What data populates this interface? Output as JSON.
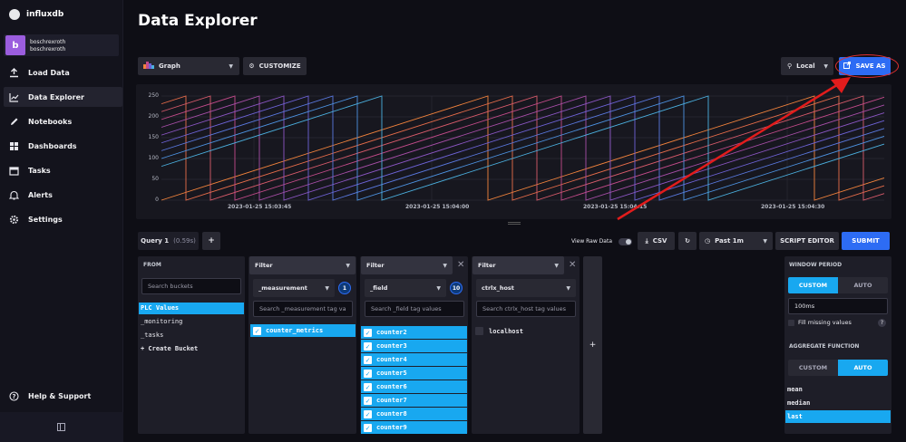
{
  "brand": "influxdb",
  "user": {
    "initial": "b",
    "line1": "boschrexroth",
    "line2": "boschrexroth"
  },
  "nav": [
    {
      "label": "Load Data",
      "icon": "upload-icon"
    },
    {
      "label": "Data Explorer",
      "icon": "graph-icon"
    },
    {
      "label": "Notebooks",
      "icon": "pencil-icon"
    },
    {
      "label": "Dashboards",
      "icon": "dashboard-icon"
    },
    {
      "label": "Tasks",
      "icon": "calendar-icon"
    },
    {
      "label": "Alerts",
      "icon": "bell-icon"
    },
    {
      "label": "Settings",
      "icon": "gear-icon"
    }
  ],
  "help": "Help & Support",
  "page_title": "Data Explorer",
  "toolbar": {
    "graph_type": "Graph",
    "customize": "CUSTOMIZE",
    "timezone": "Local",
    "save_as": "SAVE AS"
  },
  "chart_data": {
    "type": "line",
    "y_ticks": [
      "250",
      "200",
      "150",
      "100",
      "50",
      "0"
    ],
    "x_ticks": [
      "2023-01-25 15:03:45",
      "2023-01-25 15:04:00",
      "2023-01-25 15:04:15",
      "2023-01-25 15:04:30"
    ],
    "ylim": [
      0,
      250
    ],
    "series_colors": [
      "#f2833c",
      "#e86d4a",
      "#d95b6b",
      "#c44b8a",
      "#a84ea8",
      "#8c56c4",
      "#6e63d8",
      "#5a79e0",
      "#4d93e2",
      "#4bb0df"
    ],
    "series": [
      {
        "offset": 0
      },
      {
        "offset": 20
      },
      {
        "offset": 40
      },
      {
        "offset": 60
      },
      {
        "offset": 80
      },
      {
        "offset": 100
      },
      {
        "offset": 120
      },
      {
        "offset": 140
      },
      {
        "offset": 160
      },
      {
        "offset": 180
      }
    ]
  },
  "query": {
    "tab": "Query 1",
    "tab_time": "(0.59s)",
    "add": "+",
    "view_raw": "View Raw Data",
    "csv": "CSV",
    "time_range": "Past 1m",
    "script_editor": "SCRIPT EDITOR",
    "submit": "SUBMIT"
  },
  "from": {
    "title": "FROM",
    "search_placeholder": "Search buckets",
    "items": [
      "PLC Values",
      "_monitoring",
      "_tasks",
      "+ Create Bucket"
    ]
  },
  "filter1": {
    "title": "Filter",
    "key": "_measurement",
    "count": "1",
    "search_placeholder": "Search _measurement tag va",
    "values": [
      "counter_metrics"
    ]
  },
  "filter2": {
    "title": "Filter",
    "key": "_field",
    "count": "10",
    "search_placeholder": "Search _field tag values",
    "values": [
      "counter2",
      "counter3",
      "counter4",
      "counter5",
      "counter6",
      "counter7",
      "counter8",
      "counter9"
    ]
  },
  "filter3": {
    "title": "Filter",
    "key": "ctrlx_host",
    "search_placeholder": "Search ctrlx_host tag values",
    "values": [
      "localhost"
    ]
  },
  "add_filter": "+",
  "window": {
    "title": "WINDOW PERIOD",
    "custom": "CUSTOM",
    "auto": "AUTO",
    "period_value": "100ms",
    "fill_missing": "Fill missing values",
    "help": "?",
    "aggregate_title": "AGGREGATE FUNCTION",
    "agg_custom": "CUSTOM",
    "agg_auto": "AUTO",
    "functions": [
      "mean",
      "median",
      "last"
    ]
  }
}
